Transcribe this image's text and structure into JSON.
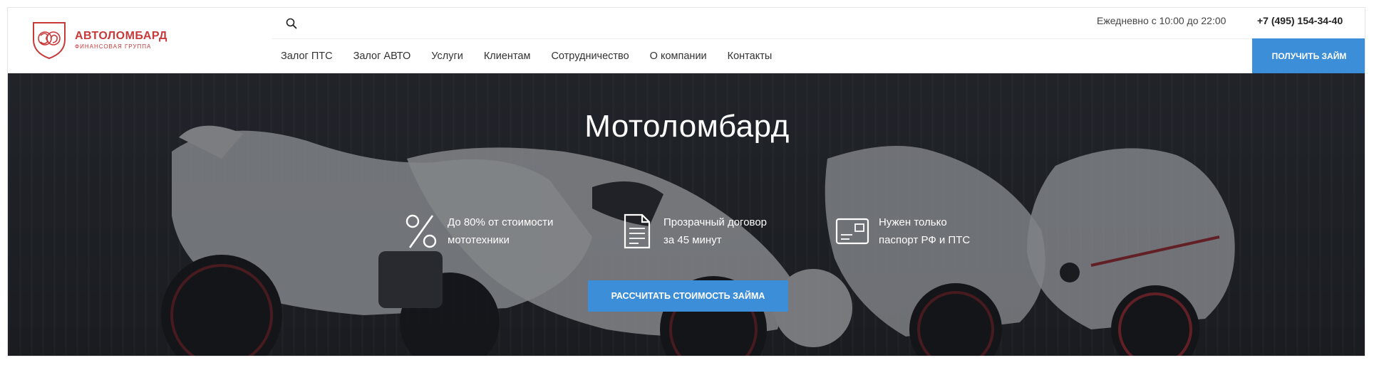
{
  "brand": {
    "name": "АВТОЛОМБАРД",
    "subtitle": "ФИНАНСОВАЯ ГРУППА",
    "color": "#c8393a"
  },
  "header": {
    "hours": "Ежедневно с 10:00 до 22:00",
    "phone": "+7 (495) 154-34-40",
    "cta_label": "ПОЛУЧИТЬ ЗАЙМ",
    "search_icon": "search-icon"
  },
  "nav": {
    "items": [
      {
        "label": "Залог ПТС"
      },
      {
        "label": "Залог АВТО"
      },
      {
        "label": "Услуги"
      },
      {
        "label": "Клиентам"
      },
      {
        "label": "Сотрудничество"
      },
      {
        "label": "О компании"
      },
      {
        "label": "Контакты"
      }
    ]
  },
  "hero": {
    "title": "Мотоломбард",
    "features": [
      {
        "icon": "percent-icon",
        "line1": "До 80% от стоимости",
        "line2": "мототехники"
      },
      {
        "icon": "document-icon",
        "line1": "Прозрачный договор",
        "line2": "за 45 минут"
      },
      {
        "icon": "id-card-icon",
        "line1": "Нужен только",
        "line2": "паспорт РФ и ПТС"
      }
    ],
    "cta_label": "РАССЧИТАТЬ СТОИМОСТЬ ЗАЙМА"
  },
  "colors": {
    "accent": "#3d8ed8",
    "hero_bg": "#26292e"
  }
}
